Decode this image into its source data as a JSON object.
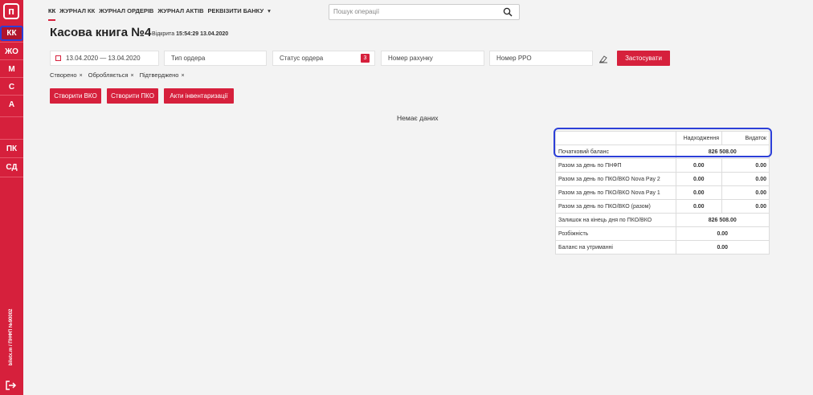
{
  "sidebar": {
    "logo": "п",
    "items": [
      {
        "label": "КК"
      },
      {
        "label": "ЖО"
      },
      {
        "label": "М"
      },
      {
        "label": "С"
      },
      {
        "label": "А"
      },
      {
        "label": "ПК"
      },
      {
        "label": "СД"
      }
    ],
    "vertical_text": "biletx.m / ПНФП №90002"
  },
  "topnav": {
    "tabs": [
      {
        "label": "КК"
      },
      {
        "label": "ЖУРНАЛ КК"
      },
      {
        "label": "ЖУРНАЛ ОРДЕРІВ"
      },
      {
        "label": "ЖУРНАЛ АКТІВ"
      },
      {
        "label": "РЕКВІЗИТИ БАНКУ"
      }
    ],
    "search_placeholder": "Пошук операції"
  },
  "page": {
    "title": "Касова книга №4",
    "opened_label": "Відкрита",
    "opened_value": "15:54:29 13.04.2020"
  },
  "filters": {
    "date_range": "13.04.2020 — 13.04.2020",
    "order_type": "Тип ордера",
    "order_status": "Статус ордера",
    "status_count": "3",
    "account_number": "Номер рахунку",
    "rro_number": "Номер РРО",
    "apply_label": "Застосувати",
    "tags": [
      {
        "label": "Створено"
      },
      {
        "label": "Обробляється"
      },
      {
        "label": "Підтверджено"
      }
    ]
  },
  "actions": {
    "create_vko": "Створити ВКО",
    "create_pko": "Створити ПКО",
    "inventory_acts": "Акти інвентаризації"
  },
  "empty_text": "Немає даних",
  "balance": {
    "col_income": "Надходження",
    "col_expense": "Видаток",
    "rows": [
      {
        "label": "Початковий баланс",
        "merged": "826 508.00"
      },
      {
        "label": "Разом за день по ПНФП",
        "income": "0.00",
        "expense": "0.00"
      },
      {
        "label": "Разом за день по ПКО/ВКО Nova Pay 2",
        "income": "0.00",
        "expense": "0.00"
      },
      {
        "label": "Разом за день по ПКО/ВКО Nova Pay 1",
        "income": "0.00",
        "expense": "0.00"
      },
      {
        "label": "Разом за день по ПКО/ВКО (разом)",
        "income": "0.00",
        "expense": "0.00"
      },
      {
        "label": "Залишок на кінець дня по ПКО/ВКО",
        "merged": "826 508.00"
      },
      {
        "label": "Розбіжність",
        "merged": "0.00"
      },
      {
        "label": "Баланс на утриманні",
        "merged": "0.00"
      }
    ]
  },
  "colors": {
    "brand": "#d6203c",
    "highlight": "#2c3fd8"
  }
}
